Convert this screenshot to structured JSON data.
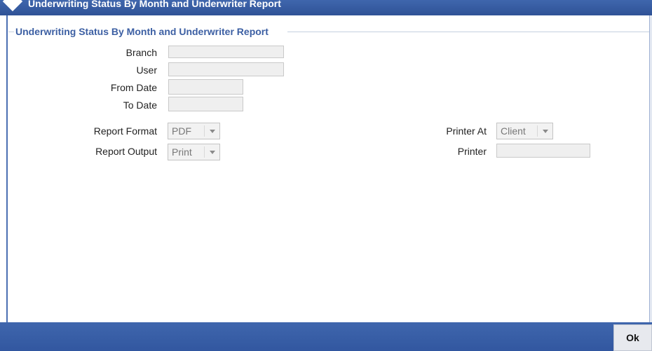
{
  "window": {
    "title": "Underwriting Status By Month and Underwriter Report"
  },
  "section": {
    "legend": "Underwriting Status By Month and Underwriter Report"
  },
  "fields": {
    "branch": {
      "label": "Branch",
      "value": ""
    },
    "user": {
      "label": "User",
      "value": ""
    },
    "from_date": {
      "label": "From Date",
      "value": ""
    },
    "to_date": {
      "label": "To Date",
      "value": ""
    },
    "report_format": {
      "label": "Report Format",
      "value": "PDF"
    },
    "report_output": {
      "label": "Report Output",
      "value": "Print"
    },
    "printer_at": {
      "label": "Printer At",
      "value": "Client"
    },
    "printer": {
      "label": "Printer",
      "value": ""
    }
  },
  "footer": {
    "ok_label": "Ok"
  },
  "colors": {
    "header_blue": "#3f66ad",
    "legend_blue": "#3c5fa3"
  },
  "icons": {
    "title_marker": "diamond-icon",
    "dropdown": "chevron-down-icon"
  }
}
